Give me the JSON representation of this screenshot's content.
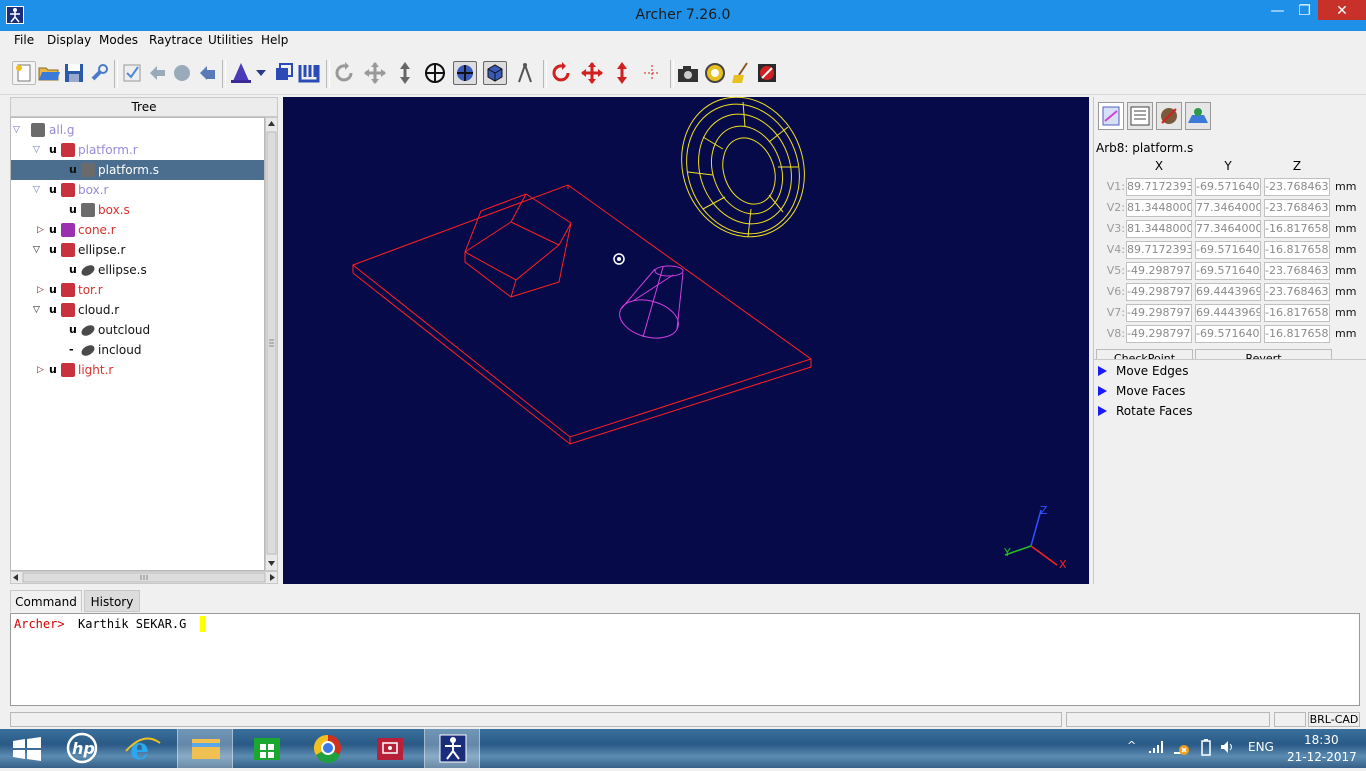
{
  "window": {
    "title": "Archer 7.26.0",
    "minimize_glyph": "—",
    "maximize_glyph": "❐",
    "close_glyph": "✕"
  },
  "menu": [
    "File",
    "Display",
    "Modes",
    "Raytrace",
    "Utilities",
    "Help"
  ],
  "tree": {
    "header": "Tree",
    "rows": [
      {
        "label": "all.g",
        "flag": "",
        "icon": "group-icon",
        "toggle": "▽",
        "depth": 0
      },
      {
        "label": "platform.r",
        "flag": "u",
        "icon": "region-icon",
        "toggle": "▽",
        "depth": 1
      },
      {
        "label": "platform.s",
        "flag": "u",
        "icon": "arb8-solid-icon",
        "toggle": "",
        "depth": 2,
        "selected": true
      },
      {
        "label": "box.r",
        "flag": "u",
        "icon": "region-icon",
        "toggle": "▽",
        "depth": 1
      },
      {
        "label": "box.s",
        "flag": "u",
        "icon": "arb8-solid-icon",
        "toggle": "",
        "depth": 2
      },
      {
        "label": "cone.r",
        "flag": "u",
        "icon": "region-icon",
        "toggle": "▷",
        "depth": 1
      },
      {
        "label": "ellipse.r",
        "flag": "u",
        "icon": "region-icon",
        "toggle": "▽",
        "depth": 1
      },
      {
        "label": "ellipse.s",
        "flag": "u",
        "icon": "ellipsoid-solid-icon",
        "toggle": "",
        "depth": 2
      },
      {
        "label": "tor.r",
        "flag": "u",
        "icon": "region-icon",
        "toggle": "▷",
        "depth": 1
      },
      {
        "label": "cloud.r",
        "flag": "u",
        "icon": "region-icon",
        "toggle": "▽",
        "depth": 1
      },
      {
        "label": "outcloud",
        "flag": "u",
        "icon": "ellipsoid-solid-icon",
        "toggle": "",
        "depth": 2
      },
      {
        "label": "incloud",
        "flag": "-",
        "icon": "ellipsoid-solid-icon",
        "toggle": "",
        "depth": 2
      },
      {
        "label": "light.r",
        "flag": "u",
        "icon": "region-icon",
        "toggle": "▷",
        "depth": 1
      }
    ]
  },
  "viewport": {
    "axis_labels": {
      "x": "X",
      "y": "Y",
      "z": "Z"
    }
  },
  "edit_panel": {
    "object_title": "Arb8: platform.s",
    "columns": [
      "X",
      "Y",
      "Z"
    ],
    "vertices": [
      {
        "label": "V1:",
        "x": "89.71723937",
        "y": "-69.5716400",
        "z": "-23.7684631",
        "unit": "mm"
      },
      {
        "label": "V2:",
        "x": "81.34480000",
        "y": "77.34640000",
        "z": "-23.7684631",
        "unit": "mm"
      },
      {
        "label": "V3:",
        "x": "81.34480000",
        "y": "77.34640000",
        "z": "-16.8176589",
        "unit": "mm"
      },
      {
        "label": "V4:",
        "x": "89.71723937",
        "y": "-69.5716400",
        "z": "-16.8176589",
        "unit": "mm"
      },
      {
        "label": "V5:",
        "x": "-49.2987976",
        "y": "-69.5716400",
        "z": "-23.7684631",
        "unit": "mm"
      },
      {
        "label": "V6:",
        "x": "-49.2987976",
        "y": "69.44439697",
        "z": "-23.7684631",
        "unit": "mm"
      },
      {
        "label": "V7:",
        "x": "-49.2987976",
        "y": "69.44439697",
        "z": "-16.8176589",
        "unit": "mm"
      },
      {
        "label": "V8:",
        "x": "-49.2987976",
        "y": "-69.5716400",
        "z": "-16.8176589",
        "unit": "mm"
      }
    ],
    "checkpoint_label": "CheckPoint",
    "revert_label": "Revert",
    "actions": [
      "Move Edges",
      "Move Faces",
      "Rotate Faces"
    ]
  },
  "command": {
    "tabs": [
      "Command",
      "History"
    ],
    "prompt": "Archer>",
    "input": "Karthik SEKAR.G"
  },
  "status": {
    "right_label": "BRL-CAD"
  },
  "taskbar": {
    "lang": "ENG",
    "time": "18:30",
    "date": "21-12-2017",
    "tray_chevron": "^"
  },
  "colors": {
    "titlebar": "#1e90e8",
    "viewport_bg": "#070a48",
    "platform_wire": "#ff2020",
    "torus_wire": "#f0e020",
    "cone_wire": "#d040e0",
    "tree_selected": "#4b6d8e",
    "prompt": "#d00000"
  }
}
